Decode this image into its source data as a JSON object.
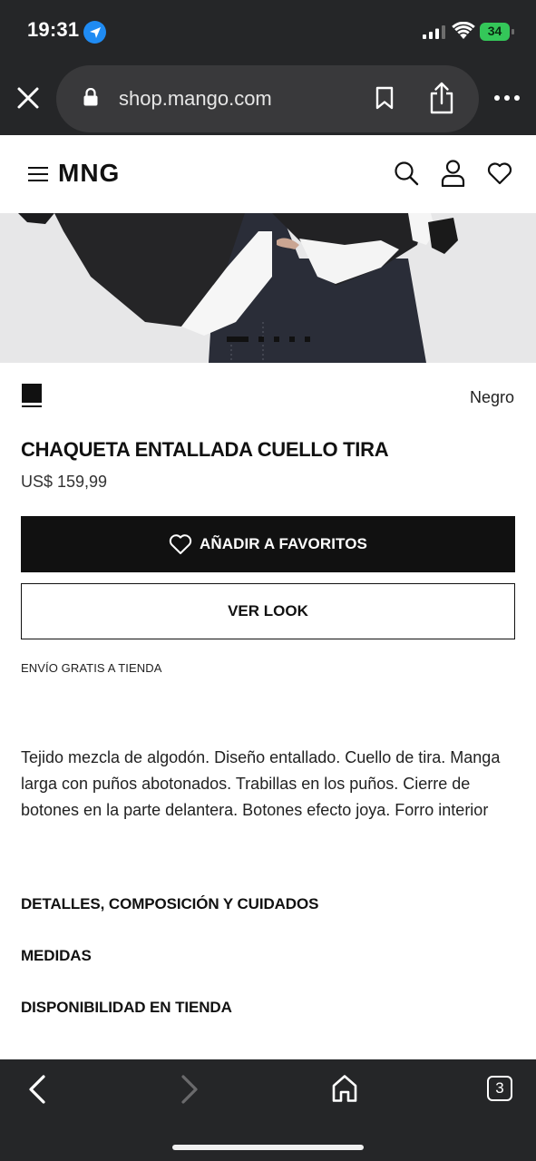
{
  "status_bar": {
    "time": "19:31",
    "battery": "34"
  },
  "browser": {
    "url": "shop.mango.com",
    "tab_count": "3",
    "icons": [
      "close-icon",
      "lock-icon",
      "bookmark-icon",
      "share-icon",
      "more-icon",
      "back-icon",
      "forward-icon",
      "home-icon"
    ]
  },
  "header": {
    "logo": "MNG",
    "icons": [
      "menu-icon",
      "search-icon",
      "account-icon",
      "heart-icon"
    ]
  },
  "gallery": {
    "image_count": 5,
    "active_index": 1
  },
  "product": {
    "color_swatch": "#111111",
    "color_name": "Negro",
    "title": "CHAQUETA ENTALLADA CUELLO TIRA",
    "price": "US$ 159,99",
    "favorite_label": "AÑADIR A FAVORITOS",
    "look_label": "VER LOOK",
    "shipping": "ENVÍO GRATIS A TIENDA",
    "description": "Tejido mezcla de algodón. Diseño entallado. Cuello de tira. Manga larga con puños abotonados. Trabillas en los puños. Cierre de botones en la parte delantera. Botones efecto joya. Forro interior"
  },
  "sections": [
    {
      "label": "DETALLES, COMPOSICIÓN Y CUIDADOS"
    },
    {
      "label": "MEDIDAS"
    },
    {
      "label": "DISPONIBILIDAD EN TIENDA"
    }
  ],
  "colors": {
    "browser_chrome": "#252628",
    "url_pill": "#39393b",
    "location_blue": "#1f8bf3",
    "battery_green": "#34c759",
    "primary_button": "#111111"
  }
}
